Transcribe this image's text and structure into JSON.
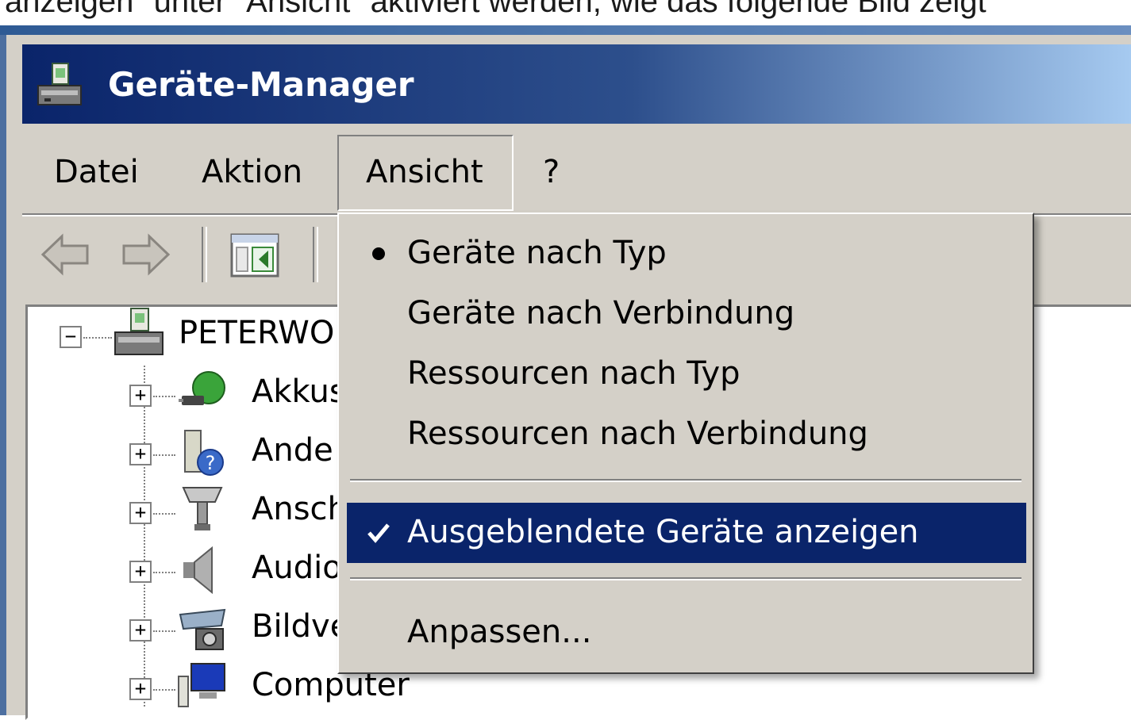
{
  "caption": "anzeigen\" unter \"Ansicht\" aktiviert werden, wie das folgende Bild zeigt",
  "window": {
    "title": "Geräte-Manager"
  },
  "menubar": {
    "items": [
      {
        "label": "Datei"
      },
      {
        "label": "Aktion"
      },
      {
        "label": "Ansicht"
      },
      {
        "label": "?"
      }
    ],
    "open_menu": "Ansicht"
  },
  "toolbar": {
    "icons": [
      "back-arrow-icon",
      "forward-arrow-icon",
      "show-hide-console-tree-icon"
    ]
  },
  "tree": {
    "root": {
      "label": "PETERWO",
      "icon": "computer-icon",
      "expanded": true
    },
    "children": [
      {
        "label": "Akkus",
        "icon": "battery-icon"
      },
      {
        "label": "Ande",
        "icon": "unknown-device-icon"
      },
      {
        "label": "Ansch",
        "icon": "port-icon"
      },
      {
        "label": "Audio",
        "icon": "speaker-icon"
      },
      {
        "label": "Bildve",
        "icon": "imaging-device-icon"
      },
      {
        "label": "Computer",
        "icon": "monitor-icon"
      }
    ]
  },
  "dropdown": {
    "items": [
      {
        "label": "Geräte nach Typ",
        "mark": "radio-bullet",
        "selected": false
      },
      {
        "label": "Geräte nach Verbindung",
        "mark": "",
        "selected": false
      },
      {
        "label": "Ressourcen nach Typ",
        "mark": "",
        "selected": false
      },
      {
        "label": "Ressourcen nach Verbindung",
        "mark": "",
        "selected": false
      },
      {
        "label": "Ausgeblendete Geräte anzeigen",
        "mark": "checkmark",
        "selected": true
      },
      {
        "label": "Anpassen...",
        "mark": "",
        "selected": false
      }
    ]
  },
  "colors": {
    "face": "#d4d0c8",
    "title_start": "#0a246a",
    "title_end": "#a6caf0",
    "highlight": "#0a246a"
  }
}
